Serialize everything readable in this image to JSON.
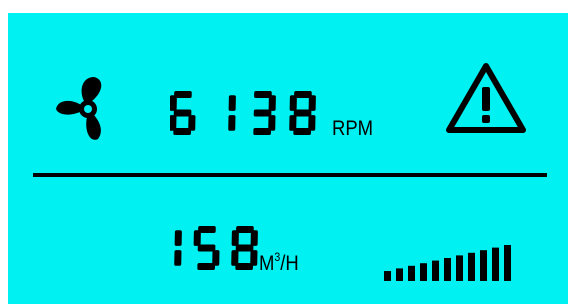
{
  "display": {
    "background_color": "#00f1f1",
    "segment_color": "#000000",
    "fan_icon": "fan-icon",
    "warning_icon": "warning-triangle-icon",
    "rpm": {
      "value": "6138",
      "unit": "RPM"
    },
    "flow": {
      "value": "158",
      "unit_base": "M",
      "unit_sup": "3",
      "unit_suffix": "/H"
    },
    "level_bars": {
      "lit": 11,
      "total": 11
    }
  }
}
